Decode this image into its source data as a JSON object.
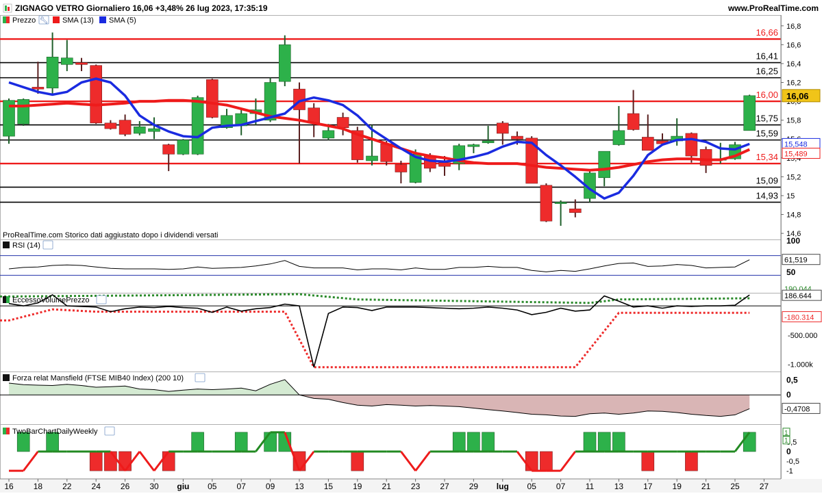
{
  "header": {
    "title": "ZIGNAGO VETRO Giornaliero 16,06 +3,48% 26 lug 2023, 17:35:19",
    "site": "www.ProRealTime.com"
  },
  "legend_main": {
    "items": [
      "Prezzo",
      "SMA (13)",
      "SMA (5)"
    ]
  },
  "footnote": "ProRealTime.com  Storico dati aggiustato dopo i dividendi versati",
  "panels": {
    "rsi": "RSI (14)",
    "volume": "EccessoVolumePrezzo",
    "mansfield": "Forza relat Mansfield (FTSE MIB40 Index) (200 10)",
    "twobar": "TwoBarChartDailyWeekly"
  },
  "colors": {
    "up": "#2db14a",
    "down": "#ee2b2b",
    "sma13": "#ee1b1b",
    "sma5": "#1a2be0",
    "resistance": "#ee1b1b",
    "support": "#000000"
  },
  "chart_data": [
    {
      "type": "candlestick",
      "title": "ZIGNAGO VETRO Giornaliero",
      "ylim": [
        14.55,
        16.9
      ],
      "y_ticks": [
        "16,8",
        "16,6",
        "16,4",
        "16,2",
        "16,0",
        "15,8",
        "15,6",
        "15,4",
        "15,2",
        "15",
        "14,8",
        "14,6"
      ],
      "x_labels": [
        "16",
        "18",
        "22",
        "24",
        "26",
        "30",
        "giu",
        "05",
        "07",
        "09",
        "13",
        "15",
        "19",
        "21",
        "23",
        "27",
        "29",
        "lug",
        "05",
        "07",
        "11",
        "13",
        "17",
        "19",
        "21",
        "25",
        "27"
      ],
      "candles": [
        {
          "o": 15.63,
          "h": 16.03,
          "l": 15.55,
          "c": 16.01
        },
        {
          "o": 15.76,
          "h": 16.03,
          "l": 15.74,
          "c": 16.02
        },
        {
          "o": 16.15,
          "h": 16.42,
          "l": 16.08,
          "c": 16.13
        },
        {
          "o": 16.14,
          "h": 16.73,
          "l": 16.08,
          "c": 16.47
        },
        {
          "o": 16.39,
          "h": 16.65,
          "l": 16.32,
          "c": 16.46
        },
        {
          "o": 16.41,
          "h": 16.46,
          "l": 16.32,
          "c": 16.39
        },
        {
          "o": 16.38,
          "h": 16.39,
          "l": 15.76,
          "c": 15.77
        },
        {
          "o": 15.77,
          "h": 15.8,
          "l": 15.7,
          "c": 15.71
        },
        {
          "o": 15.8,
          "h": 15.86,
          "l": 15.63,
          "c": 15.65
        },
        {
          "o": 15.66,
          "h": 15.79,
          "l": 15.64,
          "c": 15.73
        },
        {
          "o": 15.68,
          "h": 15.83,
          "l": 15.6,
          "c": 15.71
        },
        {
          "o": 15.54,
          "h": 15.55,
          "l": 15.26,
          "c": 15.44
        },
        {
          "o": 15.44,
          "h": 15.6,
          "l": 15.43,
          "c": 15.59
        },
        {
          "o": 15.44,
          "h": 16.06,
          "l": 15.43,
          "c": 16.04
        },
        {
          "o": 16.23,
          "h": 16.24,
          "l": 15.82,
          "c": 15.83
        },
        {
          "o": 15.72,
          "h": 15.92,
          "l": 15.71,
          "c": 15.85
        },
        {
          "o": 15.74,
          "h": 15.93,
          "l": 15.64,
          "c": 15.87
        },
        {
          "o": 15.87,
          "h": 16.03,
          "l": 15.75,
          "c": 15.91
        },
        {
          "o": 15.8,
          "h": 16.25,
          "l": 15.78,
          "c": 16.2
        },
        {
          "o": 16.21,
          "h": 16.7,
          "l": 16.16,
          "c": 16.6
        },
        {
          "o": 16.13,
          "h": 16.2,
          "l": 15.34,
          "c": 15.91
        },
        {
          "o": 15.93,
          "h": 15.98,
          "l": 15.62,
          "c": 15.77
        },
        {
          "o": 15.61,
          "h": 15.76,
          "l": 15.59,
          "c": 15.69
        },
        {
          "o": 15.83,
          "h": 15.88,
          "l": 15.64,
          "c": 15.72
        },
        {
          "o": 15.69,
          "h": 15.73,
          "l": 15.35,
          "c": 15.38
        },
        {
          "o": 15.37,
          "h": 15.75,
          "l": 15.32,
          "c": 15.42
        },
        {
          "o": 15.55,
          "h": 15.58,
          "l": 15.32,
          "c": 15.36
        },
        {
          "o": 15.33,
          "h": 15.37,
          "l": 15.13,
          "c": 15.25
        },
        {
          "o": 15.14,
          "h": 15.49,
          "l": 15.13,
          "c": 15.44
        },
        {
          "o": 15.42,
          "h": 15.45,
          "l": 15.25,
          "c": 15.29
        },
        {
          "o": 15.35,
          "h": 15.42,
          "l": 15.21,
          "c": 15.31
        },
        {
          "o": 15.34,
          "h": 15.55,
          "l": 15.27,
          "c": 15.53
        },
        {
          "o": 15.52,
          "h": 15.55,
          "l": 15.45,
          "c": 15.54
        },
        {
          "o": 15.56,
          "h": 15.74,
          "l": 15.55,
          "c": 15.58
        },
        {
          "o": 15.77,
          "h": 15.79,
          "l": 15.54,
          "c": 15.66
        },
        {
          "o": 15.63,
          "h": 15.68,
          "l": 15.54,
          "c": 15.6
        },
        {
          "o": 15.61,
          "h": 15.63,
          "l": 15.13,
          "c": 15.13
        },
        {
          "o": 15.11,
          "h": 15.13,
          "l": 14.72,
          "c": 14.73
        },
        {
          "o": 14.92,
          "h": 14.95,
          "l": 14.68,
          "c": 14.93
        },
        {
          "o": 14.86,
          "h": 14.96,
          "l": 14.77,
          "c": 14.82
        },
        {
          "o": 14.97,
          "h": 15.28,
          "l": 14.93,
          "c": 15.24
        },
        {
          "o": 15.19,
          "h": 15.47,
          "l": 15.1,
          "c": 15.47
        },
        {
          "o": 15.54,
          "h": 15.95,
          "l": 15.53,
          "c": 15.69
        },
        {
          "o": 15.87,
          "h": 16.12,
          "l": 15.69,
          "c": 15.7
        },
        {
          "o": 15.62,
          "h": 15.86,
          "l": 15.48,
          "c": 15.48
        },
        {
          "o": 15.58,
          "h": 15.66,
          "l": 15.53,
          "c": 15.55
        },
        {
          "o": 15.58,
          "h": 15.82,
          "l": 15.53,
          "c": 15.63
        },
        {
          "o": 15.66,
          "h": 15.67,
          "l": 15.35,
          "c": 15.42
        },
        {
          "o": 15.49,
          "h": 15.52,
          "l": 15.24,
          "c": 15.32
        },
        {
          "o": 15.38,
          "h": 15.56,
          "l": 15.34,
          "c": 15.39
        },
        {
          "o": 15.39,
          "h": 15.57,
          "l": 15.38,
          "c": 15.54
        },
        {
          "o": 15.69,
          "h": 16.07,
          "l": 15.69,
          "c": 16.06
        }
      ],
      "sma13": [
        15.95,
        15.95,
        15.96,
        15.97,
        15.98,
        15.97,
        15.96,
        15.97,
        15.98,
        16.0,
        16.0,
        16.01,
        16.01,
        16.0,
        15.98,
        15.96,
        15.92,
        15.88,
        15.84,
        15.82,
        15.8,
        15.77,
        15.74,
        15.71,
        15.65,
        15.6,
        15.55,
        15.5,
        15.45,
        15.42,
        15.4,
        15.37,
        15.35,
        15.34,
        15.34,
        15.34,
        15.32,
        15.3,
        15.29,
        15.28,
        15.27,
        15.28,
        15.3,
        15.33,
        15.36,
        15.38,
        15.39,
        15.39,
        15.38,
        15.38,
        15.42,
        15.489
      ],
      "sma5": [
        16.2,
        16.15,
        16.1,
        16.07,
        16.1,
        16.2,
        16.24,
        16.2,
        16.06,
        15.85,
        15.75,
        15.68,
        15.63,
        15.62,
        15.72,
        15.74,
        15.75,
        15.79,
        15.83,
        15.87,
        16.0,
        16.04,
        16.01,
        15.96,
        15.85,
        15.7,
        15.6,
        15.5,
        15.41,
        15.37,
        15.36,
        15.38,
        15.41,
        15.45,
        15.52,
        15.57,
        15.56,
        15.43,
        15.32,
        15.2,
        15.07,
        14.97,
        15.03,
        15.21,
        15.43,
        15.54,
        15.59,
        15.6,
        15.57,
        15.5,
        15.49,
        15.548
      ],
      "horizontal_lines": [
        {
          "value": 16.66,
          "label": "16,66",
          "color": "#ee1b1b"
        },
        {
          "value": 16.41,
          "label": "16,41",
          "color": "#000000"
        },
        {
          "value": 16.25,
          "label": "16,25",
          "color": "#000000"
        },
        {
          "value": 16.0,
          "label": "16,00",
          "color": "#ee1b1b"
        },
        {
          "value": 15.75,
          "label": "15,75",
          "color": "#000000"
        },
        {
          "value": 15.59,
          "label": "15,59",
          "color": "#000000"
        },
        {
          "value": 15.34,
          "label": "15,34",
          "color": "#ee1b1b"
        },
        {
          "value": 15.09,
          "label": "15,09",
          "color": "#000000"
        },
        {
          "value": 14.93,
          "label": "14,93",
          "color": "#000000"
        }
      ],
      "last_values": {
        "price": "16,06",
        "sma5": "15,548",
        "sma13": "15,489"
      }
    },
    {
      "type": "line",
      "title": "RSI (14)",
      "ylim": [
        0,
        100
      ],
      "y_ticks": [
        "100",
        "50"
      ],
      "band": [
        70,
        30
      ],
      "values": [
        43,
        46,
        47,
        50,
        51,
        50,
        47,
        44,
        43,
        43,
        43,
        42,
        43,
        47,
        44,
        45,
        46,
        49,
        53,
        60,
        48,
        45,
        45,
        45,
        41,
        43,
        43,
        41,
        45,
        42,
        42,
        46,
        46,
        48,
        46,
        46,
        40,
        37,
        40,
        38,
        43,
        49,
        54,
        55,
        48,
        49,
        52,
        50,
        45,
        46,
        47,
        61.519
      ],
      "last_label": "61,519"
    },
    {
      "type": "line",
      "title": "EccessoVolumePrezzo",
      "ylim": [
        -1100000,
        200000
      ],
      "y_ticks": [
        "-500.000",
        "-1.000k"
      ],
      "values": [
        40000,
        0,
        50000,
        190000,
        0,
        -10000,
        -20000,
        -100000,
        -50000,
        -20000,
        -30000,
        -10000,
        -30000,
        -40000,
        -110000,
        -20000,
        -90000,
        -50000,
        -30000,
        30000,
        0,
        -1050000,
        -130000,
        -20000,
        -30000,
        -80000,
        -20000,
        -20000,
        -20000,
        -30000,
        -40000,
        -50000,
        -40000,
        -20000,
        -40000,
        -70000,
        -150000,
        -110000,
        -40000,
        -90000,
        -70000,
        170000,
        80000,
        -20000,
        0,
        -40000,
        0,
        -10000,
        0,
        0,
        10000,
        186644
      ],
      "upper_band": [
        {
          "x": 0,
          "v": 160000
        },
        {
          "x": 20,
          "v": 200000
        },
        {
          "x": 24,
          "v": 110000
        },
        {
          "x": 40,
          "v": 50000
        },
        {
          "x": 42,
          "v": 110000
        },
        {
          "x": 51,
          "v": 130000
        }
      ],
      "lower_band": [
        {
          "x": 0,
          "v": -250000
        },
        {
          "x": 3,
          "v": -60000
        },
        {
          "x": 6,
          "v": -100000
        },
        {
          "x": 19,
          "v": -100000
        },
        {
          "x": 21,
          "v": -1050000
        },
        {
          "x": 39,
          "v": -1050000
        },
        {
          "x": 42,
          "v": -120000
        },
        {
          "x": 51,
          "v": -120000
        }
      ],
      "last_labels": {
        "line": "186.644",
        "lower": "-180.314",
        "upper": "190.044"
      }
    },
    {
      "type": "area",
      "title": "Forza relat Mansfield (FTSE MIB40 Index) (200 10)",
      "ylim": [
        -0.95,
        0.75
      ],
      "y_ticks": [
        "0,5",
        "0"
      ],
      "values": [
        0.4,
        0.35,
        0.33,
        0.32,
        0.36,
        0.32,
        0.26,
        0.28,
        0.3,
        0.2,
        0.18,
        0.12,
        0.16,
        0.2,
        0.18,
        0.2,
        0.23,
        0.14,
        0.36,
        0.52,
        0.0,
        -0.12,
        -0.15,
        -0.26,
        -0.35,
        -0.38,
        -0.33,
        -0.35,
        -0.38,
        -0.36,
        -0.38,
        -0.4,
        -0.45,
        -0.5,
        -0.55,
        -0.6,
        -0.66,
        -0.68,
        -0.72,
        -0.73,
        -0.64,
        -0.62,
        -0.66,
        -0.62,
        -0.55,
        -0.56,
        -0.6,
        -0.66,
        -0.7,
        -0.73,
        -0.68,
        -0.4708
      ],
      "last_label": "-0,4708"
    },
    {
      "type": "bar",
      "title": "TwoBarChartDailyWeekly",
      "ylim": [
        -1.35,
        1.35
      ],
      "y_ticks": [
        "0,5",
        "0",
        "-0,5",
        "-1"
      ],
      "daily": [
        0,
        1,
        0,
        1,
        0,
        0,
        -1,
        -1,
        -1,
        0,
        0,
        -1,
        0,
        1,
        0,
        0,
        1,
        0,
        1,
        1,
        -1,
        0,
        0,
        0,
        -1,
        0,
        0,
        0,
        0,
        0,
        0,
        1,
        1,
        1,
        0,
        0,
        -1,
        -1,
        0,
        0,
        1,
        1,
        1,
        0,
        -1,
        0,
        0,
        -1,
        0,
        0,
        0,
        1
      ],
      "weekly": [
        -1,
        -1,
        0,
        0,
        0,
        0,
        0,
        0,
        -1,
        0,
        -1,
        0,
        0,
        0,
        0,
        0,
        0,
        0,
        1,
        1,
        -1,
        0,
        0,
        0,
        0,
        0,
        0,
        0,
        -1,
        0,
        0,
        0,
        0,
        0,
        0,
        0,
        -1,
        -1,
        -1,
        0,
        0,
        0,
        0,
        0,
        0,
        0,
        0,
        0,
        0,
        0,
        0,
        1
      ],
      "last_labels": [
        "1",
        "1"
      ]
    }
  ]
}
